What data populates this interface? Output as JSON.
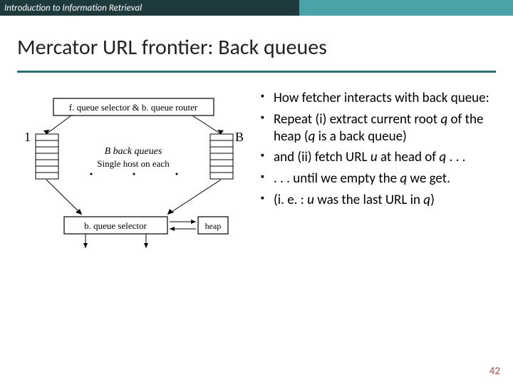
{
  "header": {
    "course": "Introduction to Information Retrieval"
  },
  "title": "Mercator URL frontier: Back queues",
  "diagram": {
    "top_box": "f. queue selector & b. queue router",
    "left_label": "1",
    "right_label": "B",
    "mid1": "B back queues",
    "mid2": "Single host on each",
    "bottom_box": "b. queue selector",
    "heap_box": "heap"
  },
  "bullets": {
    "b1a": "How fetcher interacts with back queue:",
    "b2a": "Repeat (i) extract current root ",
    "b2b": " of the heap (",
    "b2c": " is a back queue)",
    "b3a": "and (ii) fetch URL ",
    "b3b": " at head of ",
    "b3c": " . . .",
    "b4a": ". . . until we empty the ",
    "b4b": " we get.",
    "b5a": "(i. e. : ",
    "b5b": " was the last URL in ",
    "b5c": ")",
    "q": "q",
    "u": "u"
  },
  "page": "42"
}
